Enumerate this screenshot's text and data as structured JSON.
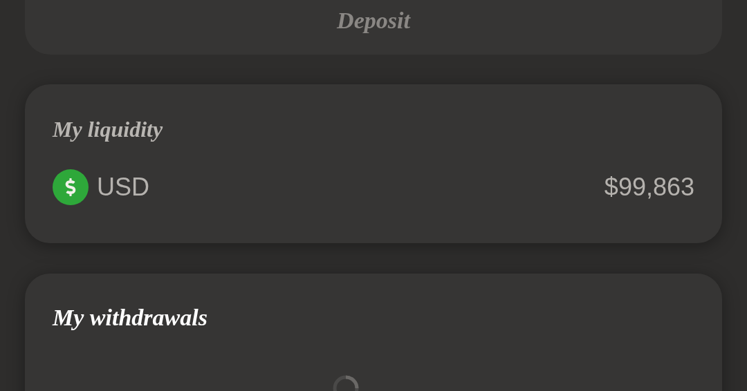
{
  "deposit_button": {
    "label": "Deposit",
    "disabled": true
  },
  "liquidity": {
    "title": "My liquidity",
    "rows": [
      {
        "currency": "USD",
        "amount": "$99,863"
      }
    ]
  },
  "withdrawals": {
    "title": "My withdrawals",
    "loading": true
  }
}
